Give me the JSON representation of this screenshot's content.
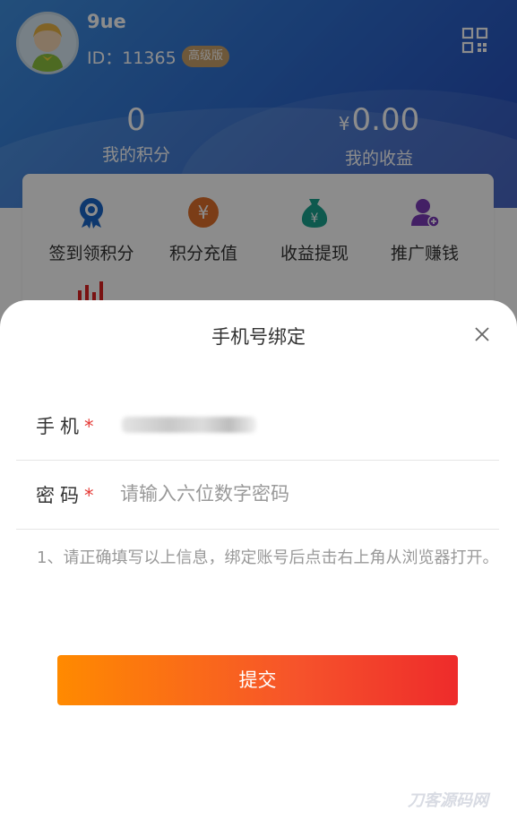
{
  "profile": {
    "username": "9ue",
    "id_text": "ID：11365",
    "level": "高级版"
  },
  "stats": {
    "points_value": "0",
    "points_label": "我的积分",
    "currency_symbol": "¥",
    "earnings_value": "0.00",
    "earnings_label": "我的收益"
  },
  "menu": {
    "items": [
      {
        "label": "签到领积分",
        "icon": "medal-icon"
      },
      {
        "label": "积分充值",
        "icon": "yen-coin-icon"
      },
      {
        "label": "收益提现",
        "icon": "money-bag-icon"
      },
      {
        "label": "推广赚钱",
        "icon": "add-user-icon"
      }
    ]
  },
  "modal": {
    "title": "手机号绑定",
    "phone_label": "手机",
    "password_label": "密码",
    "required_mark": "*",
    "password_placeholder": "请输入六位数字密码",
    "notice": "1、请正确填写以上信息，绑定账号后点击右上角从浏览器打开。",
    "submit_label": "提交"
  },
  "watermark": "刀客源码网",
  "colors": {
    "header_blue": "#2f6fd0",
    "accent_orange": "#ff8a00",
    "accent_red": "#ee2b2b",
    "required_red": "#e53935",
    "badge_gold": "#c9a06a"
  }
}
